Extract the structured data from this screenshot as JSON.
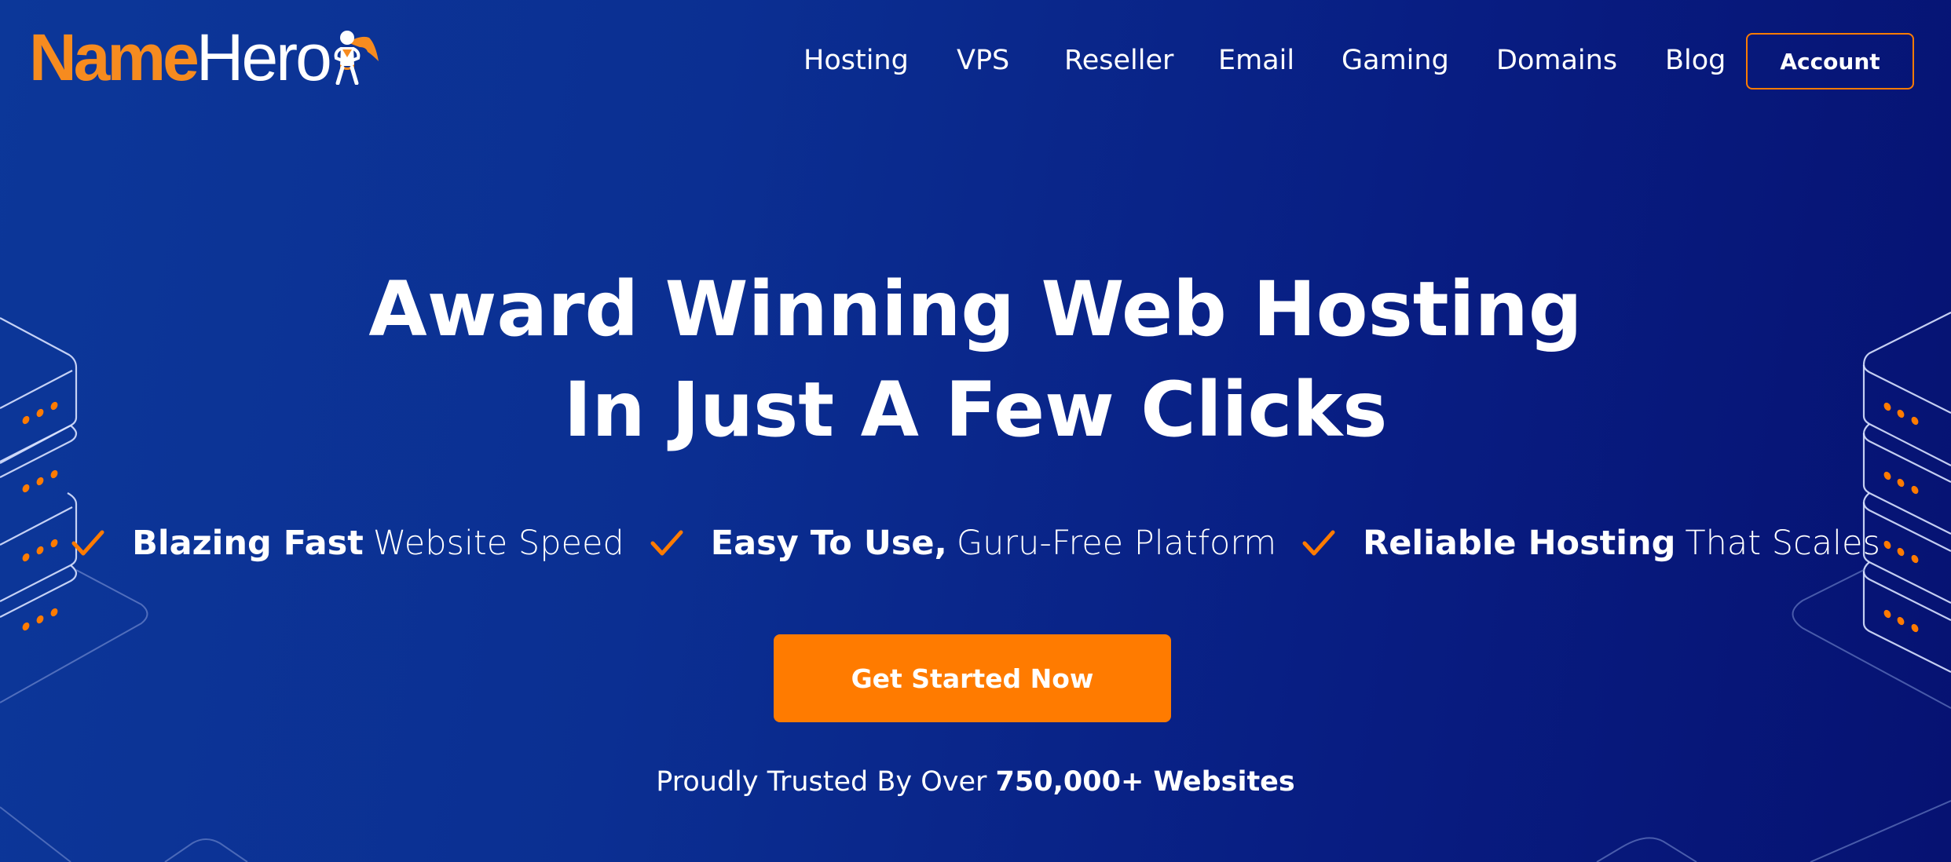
{
  "brand": {
    "name_part1": "Name",
    "name_part2": "Hero",
    "logo_icon": "superhero-mascot-icon",
    "colors": {
      "orange": "#f68b1f",
      "accent_orange": "#ff7b00",
      "bg_left": "#0c3799",
      "bg_right": "#061272",
      "text": "#ffffff"
    }
  },
  "nav": {
    "items": [
      {
        "label": "Hosting"
      },
      {
        "label": "VPS"
      },
      {
        "label": "Reseller"
      },
      {
        "label": "Email"
      },
      {
        "label": "Gaming"
      },
      {
        "label": "Domains"
      },
      {
        "label": "Blog"
      }
    ],
    "account_label": "Account"
  },
  "hero": {
    "headline_line1": "Award Winning Web Hosting",
    "headline_line2": "In Just A Few Clicks",
    "features": [
      {
        "icon": "checkmark-icon",
        "bold": "Blazing Fast",
        "rest": "Website Speed"
      },
      {
        "icon": "checkmark-icon",
        "bold": "Easy To Use,",
        "rest": "Guru-Free Platform"
      },
      {
        "icon": "checkmark-icon",
        "bold": "Reliable Hosting",
        "rest": "That Scales"
      }
    ],
    "cta_label": "Get Started Now",
    "trust_prefix": "Proudly Trusted By Over",
    "trust_bold": "750,000+ Websites"
  },
  "decorations": {
    "left_graphic": "server-stack-illustration",
    "right_graphic": "server-stack-illustration"
  }
}
